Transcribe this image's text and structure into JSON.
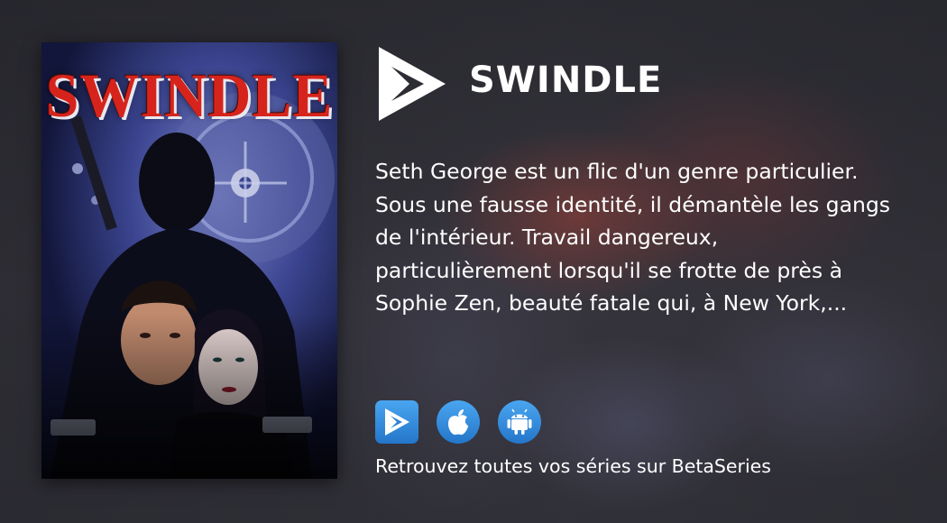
{
  "series": {
    "title": "SWINDLE",
    "poster_title": "SWINDLE",
    "synopsis": "Seth George est un flic d'un genre particulier. Sous une fausse identité, il démantèle les gangs de l'intérieur. Travail dangereux, particulièrement lorsqu'il se frotte de près à Sophie Zen, beauté fatale qui, à New York,..."
  },
  "logo": {
    "icon": "betaseries-play-logo-icon",
    "color": "#ffffff"
  },
  "apps": [
    {
      "name": "BetaSeries",
      "icon": "betaseries-icon"
    },
    {
      "name": "Apple",
      "icon": "apple-icon"
    },
    {
      "name": "Android",
      "icon": "android-icon"
    }
  ],
  "footer": {
    "text": "Retrouvez toutes vos séries sur BetaSeries"
  },
  "colors": {
    "accent_blue": "#3a8fe0",
    "poster_title_red": "#d6241c",
    "text": "#ffffff"
  }
}
